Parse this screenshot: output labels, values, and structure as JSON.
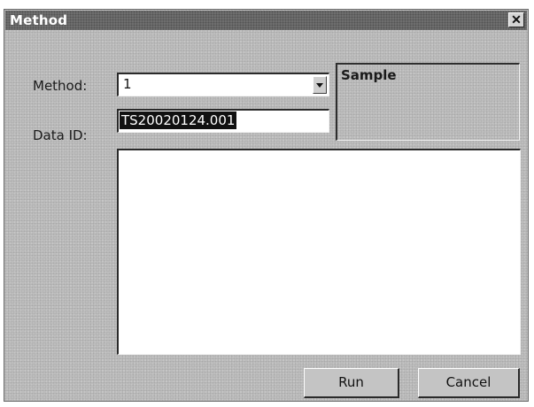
{
  "window": {
    "title": "Method",
    "close_symbol": "✕"
  },
  "form": {
    "method_label": "Method:",
    "method_value": "1",
    "data_id_label": "Data ID:",
    "data_id_value": "TS20020124.001"
  },
  "sample_group": {
    "label": "Sample"
  },
  "buttons": {
    "run_label": "Run",
    "cancel_label": "Cancel"
  },
  "icons": {
    "close": "close-icon",
    "dropdown": "chevron-down-icon"
  }
}
